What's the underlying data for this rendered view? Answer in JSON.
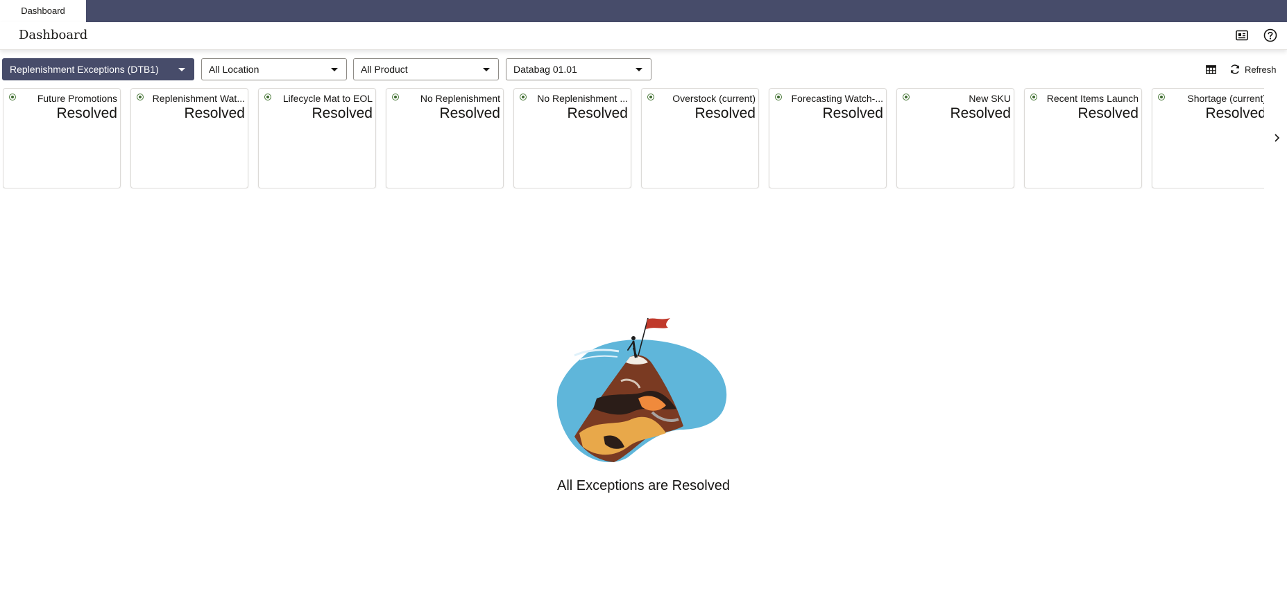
{
  "tabs": [
    {
      "label": "Dashboard",
      "active": true
    }
  ],
  "header": {
    "title": "Dashboard",
    "icons": [
      "dashboard-view-icon",
      "help-icon"
    ]
  },
  "toolbar": {
    "dashboard_select": "Replenishment Exceptions (DTB1)",
    "location_select": "All Location",
    "product_select": "All Product",
    "databag_select": "Databag 01.01",
    "table_icon": "table-icon",
    "refresh_label": "Refresh"
  },
  "tiles": [
    {
      "name": "Future Promotions",
      "status": "Resolved"
    },
    {
      "name": "Replenishment Wat...",
      "status": "Resolved"
    },
    {
      "name": "Lifecycle Mat to EOL",
      "status": "Resolved"
    },
    {
      "name": "No Replenishment",
      "status": "Resolved"
    },
    {
      "name": "No Replenishment ...",
      "status": "Resolved"
    },
    {
      "name": "Overstock (current)",
      "status": "Resolved"
    },
    {
      "name": "Forecasting Watch-...",
      "status": "Resolved"
    },
    {
      "name": "New SKU",
      "status": "Resolved"
    },
    {
      "name": "Recent Items Launch",
      "status": "Resolved"
    },
    {
      "name": "Shortage (current)",
      "status": "Resolved"
    }
  ],
  "empty_state": {
    "message": "All Exceptions are Resolved",
    "illustration": "mountain-summit-flag-illustration"
  },
  "colors": {
    "brand_bar": "#474c6a",
    "status_dot": "#3d6b2f",
    "flag": "#c0392b",
    "sky": "#5fb6da"
  }
}
